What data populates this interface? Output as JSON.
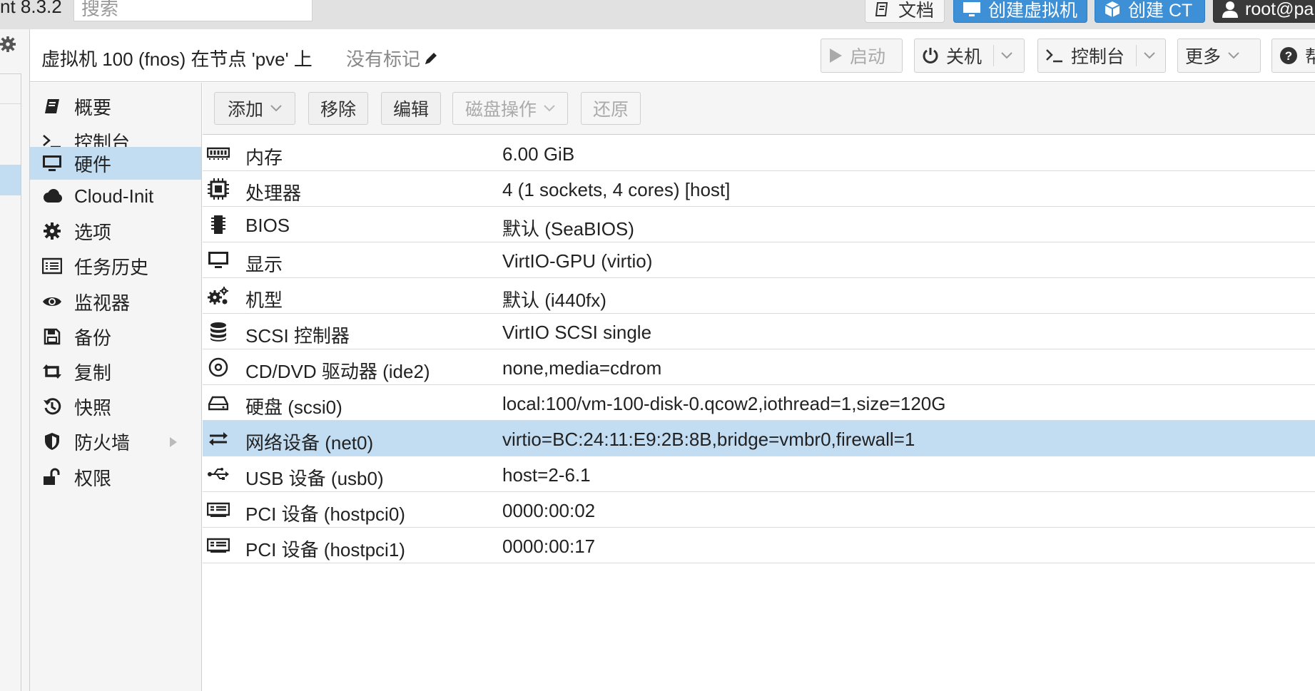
{
  "topbar": {
    "version": "nt 8.3.2",
    "search_placeholder": "搜索",
    "docs_label": "文档",
    "create_vm_label": "创建虚拟机",
    "create_ct_label": "创建 CT",
    "user_label": "root@pa"
  },
  "header": {
    "title": "虚拟机 100 (fnos) 在节点 'pve' 上",
    "tags_label": "没有标记",
    "start_label": "启动",
    "shutdown_label": "关机",
    "console_label": "控制台",
    "more_label": "更多",
    "help_label": "帮"
  },
  "nav": {
    "items": [
      {
        "label": "概要",
        "icon": "book-icon"
      },
      {
        "label": "控制台",
        "icon": "terminal-icon"
      },
      {
        "label": "硬件",
        "icon": "desktop-icon"
      },
      {
        "label": "Cloud-Init",
        "icon": "cloud-icon"
      },
      {
        "label": "选项",
        "icon": "gear-icon"
      },
      {
        "label": "任务历史",
        "icon": "list-icon"
      },
      {
        "label": "监视器",
        "icon": "eye-icon"
      },
      {
        "label": "备份",
        "icon": "floppy-icon"
      },
      {
        "label": "复制",
        "icon": "retweet-icon"
      },
      {
        "label": "快照",
        "icon": "history-icon"
      },
      {
        "label": "防火墙",
        "icon": "shield-icon"
      },
      {
        "label": "权限",
        "icon": "unlock-icon"
      }
    ],
    "active_index": 2
  },
  "toolbar": {
    "add_label": "添加",
    "remove_label": "移除",
    "edit_label": "编辑",
    "disk_action_label": "磁盘操作",
    "revert_label": "还原"
  },
  "hardware": {
    "rows": [
      {
        "icon": "memory-icon",
        "name": "内存",
        "value": "6.00 GiB"
      },
      {
        "icon": "cpu-icon",
        "name": "处理器",
        "value": "4 (1 sockets, 4 cores) [host]"
      },
      {
        "icon": "microchip-icon",
        "name": "BIOS",
        "value": "默认 (SeaBIOS)"
      },
      {
        "icon": "display-icon",
        "name": "显示",
        "value": "VirtIO-GPU (virtio)"
      },
      {
        "icon": "cogs-icon",
        "name": "机型",
        "value": "默认 (i440fx)"
      },
      {
        "icon": "database-icon",
        "name": "SCSI 控制器",
        "value": "VirtIO SCSI single"
      },
      {
        "icon": "cdrom-icon",
        "name": "CD/DVD 驱动器 (ide2)",
        "value": "none,media=cdrom"
      },
      {
        "icon": "harddisk-icon",
        "name": "硬盘 (scsi0)",
        "value": "local:100/vm-100-disk-0.qcow2,iothread=1,size=120G"
      },
      {
        "icon": "network-icon",
        "name": "网络设备 (net0)",
        "value": "virtio=BC:24:11:E9:2B:8B,bridge=vmbr0,firewall=1"
      },
      {
        "icon": "usb-icon",
        "name": "USB 设备 (usb0)",
        "value": "host=2-6.1"
      },
      {
        "icon": "pci-icon",
        "name": "PCI 设备 (hostpci0)",
        "value": "0000:00:02"
      },
      {
        "icon": "pci-icon",
        "name": "PCI 设备 (hostpci1)",
        "value": "0000:00:17"
      }
    ],
    "selected_index": 8
  },
  "colors": {
    "selection": "#c2dcf2",
    "primary_button": "#3d8fd6",
    "user_button": "#3a3a3a"
  }
}
